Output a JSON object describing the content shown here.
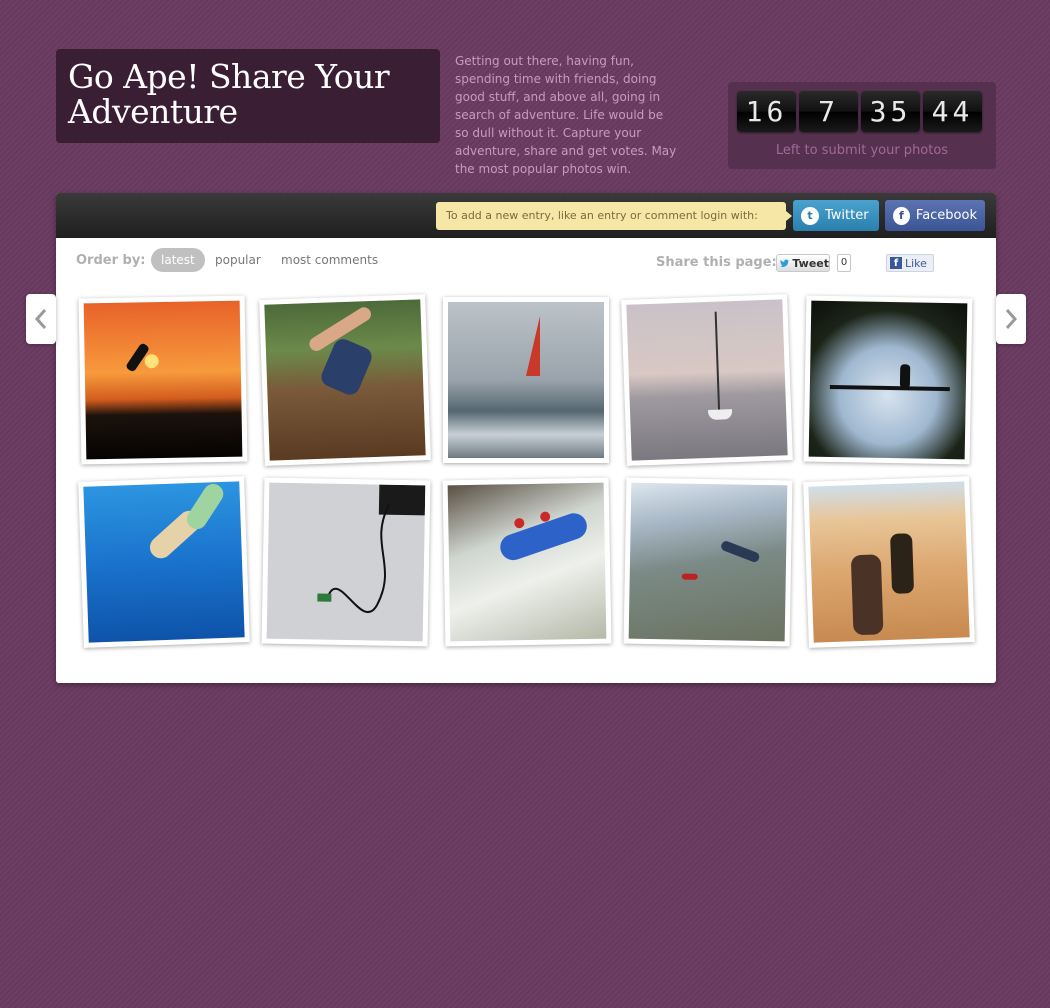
{
  "header": {
    "title": "Go Ape! Share Your Adventure",
    "intro": "Getting out there, having fun, spending time with friends, doing good stuff, and above all, going in search of adventure. Life would be so dull without it. Capture your adventure, share and get votes. May the most popular photos win."
  },
  "countdown": {
    "days": "16",
    "hours": "7",
    "minutes": "35",
    "seconds": "44",
    "label": "Left to submit your photos"
  },
  "login": {
    "note": "To add a new entry, like an entry or comment login with:",
    "twitter_label": "Twitter",
    "facebook_label": "Facebook"
  },
  "order": {
    "label": "Order by:",
    "options": [
      "latest",
      "popular",
      "most comments"
    ],
    "active": "latest"
  },
  "share": {
    "label": "Share this page:",
    "tweet_label": "Tweet",
    "tweet_count": "0",
    "like_label": "Like"
  },
  "photos": [
    {
      "subject": "cliff-jump-sunset"
    },
    {
      "subject": "zipline-fall"
    },
    {
      "subject": "windsurfer"
    },
    {
      "subject": "sailboat"
    },
    {
      "subject": "treetop-rope-bridge"
    },
    {
      "subject": "underwater-swimmer"
    },
    {
      "subject": "bungee-jump"
    },
    {
      "subject": "white-water-rafting"
    },
    {
      "subject": "skydivers"
    },
    {
      "subject": "desert-camel-ride"
    }
  ],
  "colors": {
    "background": "#6a3a60",
    "title_box": "#3a1e34",
    "twitter": "#2a7fad",
    "facebook": "#3b5495",
    "login_note": "#f6e7a6"
  },
  "icons": {
    "prev": "chevron-left-icon",
    "next": "chevron-right-icon",
    "twitter": "twitter-bird-icon",
    "facebook": "facebook-f-icon"
  }
}
